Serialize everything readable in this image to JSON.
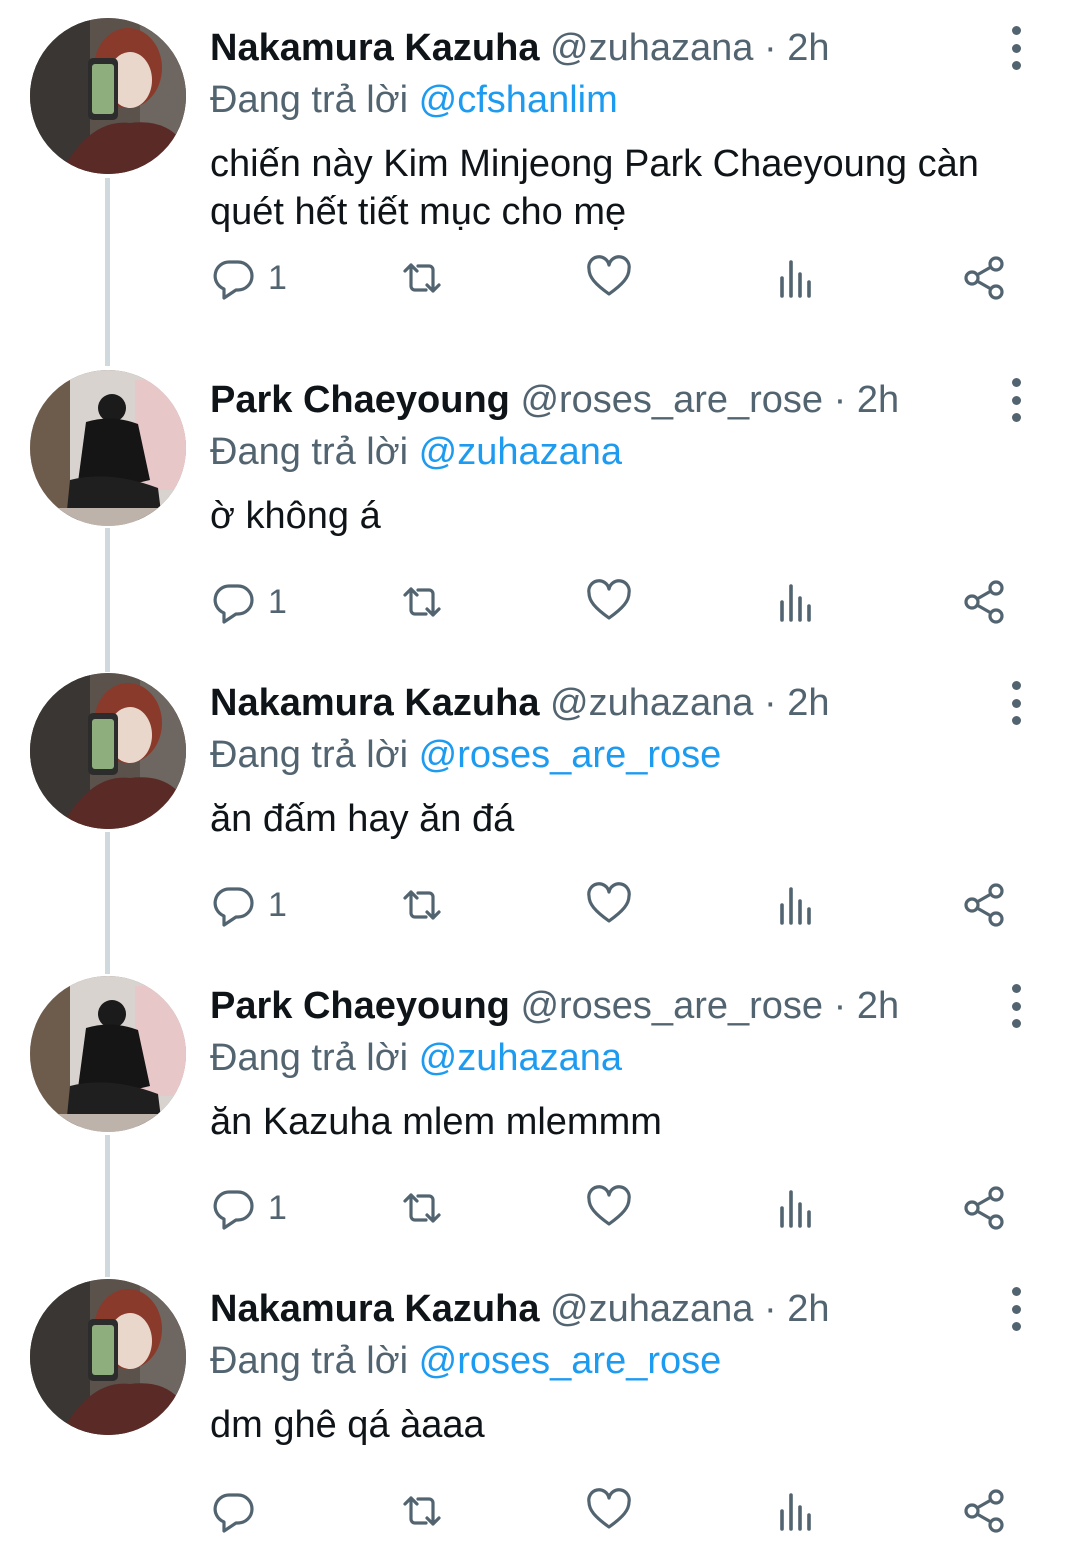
{
  "tweets": [
    {
      "name": "Nakamura Kazuha",
      "handle": "@zuhazana",
      "separator": "·",
      "time": "2h",
      "reply_prefix": "Đang trả lời",
      "reply_to": "@cfshanlim",
      "text": "chiến này Kim Minjeong Park Chaeyoung càn quét hết tiết mục cho mẹ",
      "reply_count": "1",
      "avatar": "kazuha"
    },
    {
      "name": "Park Chaeyoung",
      "handle": "@roses_are_rose",
      "separator": "·",
      "time": "2h",
      "reply_prefix": "Đang trả lời",
      "reply_to": "@zuhazana",
      "text": "ờ không á",
      "reply_count": "1",
      "avatar": "chaeyoung"
    },
    {
      "name": "Nakamura Kazuha",
      "handle": "@zuhazana",
      "separator": "·",
      "time": "2h",
      "reply_prefix": "Đang trả lời",
      "reply_to": "@roses_are_rose",
      "text": "ăn đấm hay ăn đá",
      "reply_count": "1",
      "avatar": "kazuha"
    },
    {
      "name": "Park Chaeyoung",
      "handle": "@roses_are_rose",
      "separator": "·",
      "time": "2h",
      "reply_prefix": "Đang trả lời",
      "reply_to": "@zuhazana",
      "text": "ăn Kazuha mlem mlemmm",
      "reply_count": "1",
      "avatar": "chaeyoung"
    },
    {
      "name": "Nakamura Kazuha",
      "handle": "@zuhazana",
      "separator": "·",
      "time": "2h",
      "reply_prefix": "Đang trả lời",
      "reply_to": "@roses_are_rose",
      "text": "dm ghê qá àaaa",
      "reply_count": "",
      "avatar": "kazuha"
    }
  ],
  "icons": {
    "reply": "reply-icon",
    "retweet": "retweet-icon",
    "like": "heart-icon",
    "views": "views-icon",
    "share": "share-icon",
    "more": "more-icon"
  },
  "colors": {
    "text": "#0f1419",
    "secondary": "#536471",
    "link": "#1d9bf0",
    "thread_line": "#cfd9de",
    "background": "#ffffff"
  }
}
